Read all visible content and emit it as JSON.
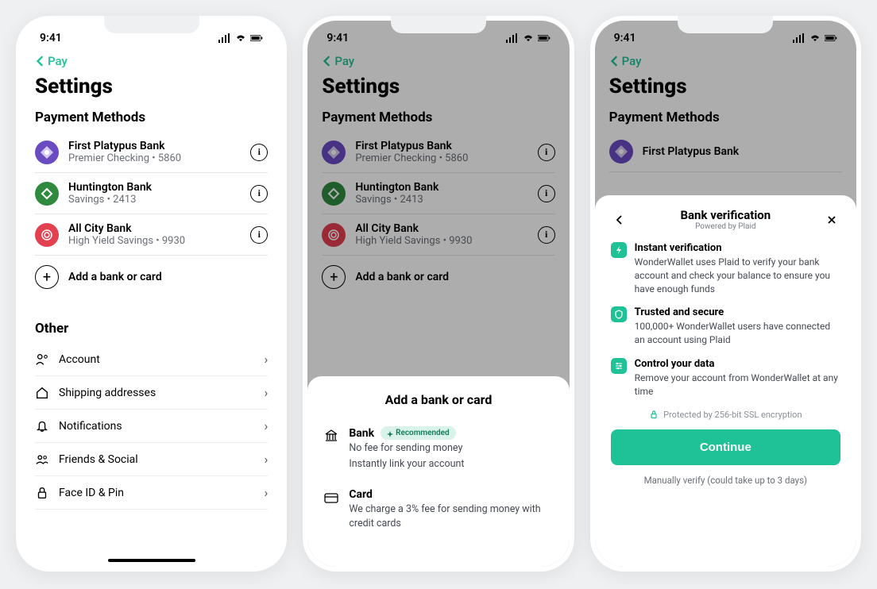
{
  "status": {
    "time": "9:41"
  },
  "nav": {
    "back_label": "Pay"
  },
  "page": {
    "title": "Settings"
  },
  "sections": {
    "payment_methods_title": "Payment Methods",
    "other_title": "Other"
  },
  "payment_methods": [
    {
      "name": "First Platypus Bank",
      "sub": "Premier Checking • 5860",
      "color": "#6b4bc2"
    },
    {
      "name": "Huntington Bank",
      "sub": "Savings • 2413",
      "color": "#2f8a3f"
    },
    {
      "name": "All City Bank",
      "sub": "High Yield Savings • 9930",
      "color": "#e34050"
    }
  ],
  "add_row": {
    "label": "Add a bank or card"
  },
  "other_items": [
    {
      "label": "Account",
      "icon": "user"
    },
    {
      "label": "Shipping addresses",
      "icon": "home"
    },
    {
      "label": "Notifications",
      "icon": "bell"
    },
    {
      "label": "Friends & Social",
      "icon": "users"
    },
    {
      "label": "Face ID & Pin",
      "icon": "lock"
    }
  ],
  "add_sheet": {
    "title": "Add a bank or card",
    "recommended_badge": "Recommended",
    "options": [
      {
        "name": "Bank",
        "desc1": "No fee for sending money",
        "desc2": "Instantly link your account",
        "recommended": true
      },
      {
        "name": "Card",
        "desc1": "We charge a 3% fee for sending money with credit cards",
        "desc2": "",
        "recommended": false
      }
    ]
  },
  "verify_sheet": {
    "title": "Bank verification",
    "subtitle": "Powered by Plaid",
    "features": [
      {
        "title": "Instant verification",
        "desc": "WonderWallet uses Plaid to verify your bank account and check your balance to ensure you have enough funds"
      },
      {
        "title": "Trusted and secure",
        "desc": "100,000+ WonderWallet users have connected an account using Plaid"
      },
      {
        "title": "Control your data",
        "desc": "Remove your account from WonderWallet at any time"
      }
    ],
    "ssl_text": "Protected by 256-bit SSL encryption",
    "continue_label": "Continue",
    "manual_label": "Manually verify (could take up to 3 days)"
  },
  "colors": {
    "accent": "#1fc296"
  }
}
